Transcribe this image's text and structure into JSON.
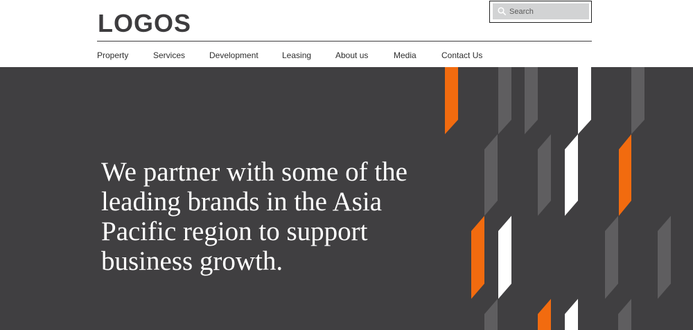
{
  "header": {
    "logo": "LOGOS",
    "search": {
      "placeholder": "Search"
    }
  },
  "nav": {
    "items": [
      {
        "label": "Property"
      },
      {
        "label": "Services"
      },
      {
        "label": "Development"
      },
      {
        "label": "Leasing"
      },
      {
        "label": "About us"
      },
      {
        "label": "Media"
      },
      {
        "label": "Contact Us"
      }
    ]
  },
  "hero": {
    "headline": "We partner with some of the leading brands in the Asia Pacific region to support business growth."
  },
  "colors": {
    "hero_background": "#403f41",
    "accent_orange": "#f26b0f",
    "stripe_gray": "#5f5e60",
    "stripe_white": "#ffffff",
    "logo_text": "#3d3c3e"
  },
  "icons": {
    "search": "magnifier-icon"
  }
}
